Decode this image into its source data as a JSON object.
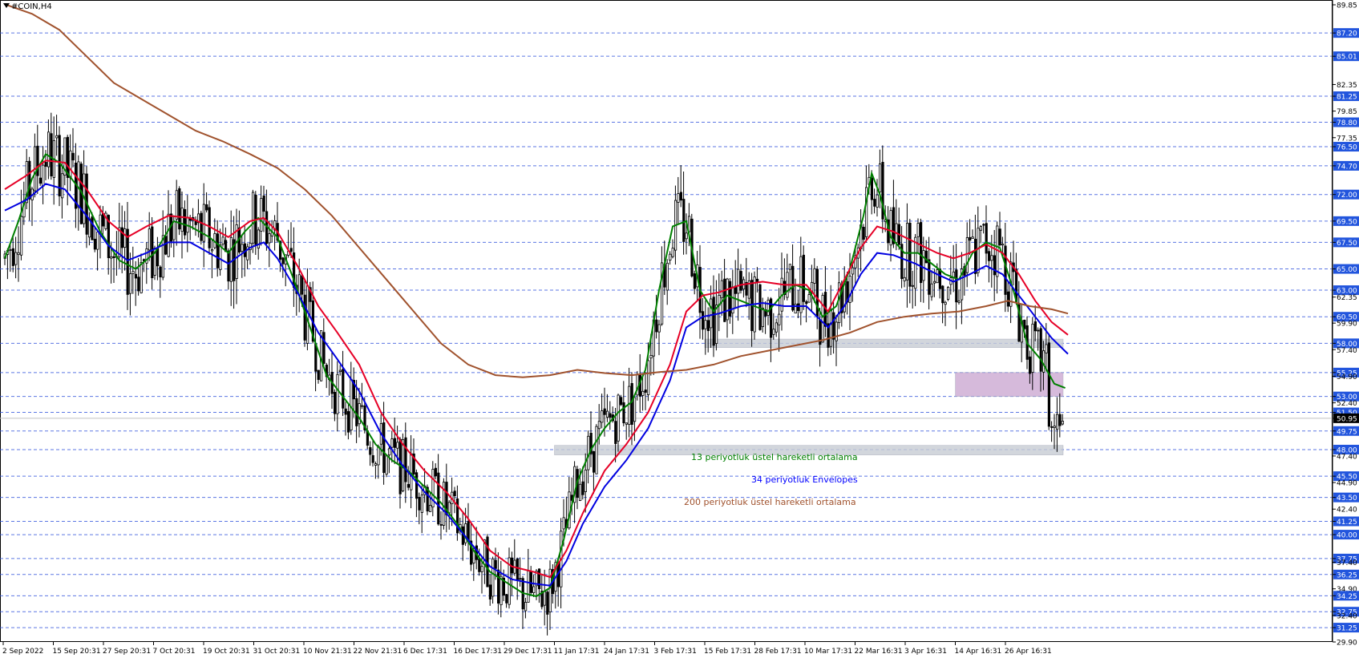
{
  "window": {
    "symbol_title": "#COIN,H4"
  },
  "annotations": [
    {
      "text": "13 periyotluk üstel hareketli ortalama",
      "color": "#008000"
    },
    {
      "text": "34 periyotluk Envelopes",
      "color": "#0000ff"
    },
    {
      "text": "200 periyotluk üstel hareketli ortalama",
      "color": "#a0522d"
    }
  ],
  "colors": {
    "grid": "#3355dd",
    "axis_tag_bg": "#2255dd",
    "candle": "#000000",
    "ema13": "#008000",
    "envelope_upper": "#e60026",
    "envelope_lower": "#0000e0",
    "ema200": "#a0522d",
    "zone_gray": "#c8ccd4",
    "zone_purple": "#c9a3cf",
    "current_price_line": "#c0c0c0"
  },
  "chart_data": {
    "type": "candlestick",
    "title": "#COIN,H4",
    "ylim": [
      29.9,
      89.85
    ],
    "grid": true,
    "x_tick_labels": [
      "2 Sep 2022",
      "15 Sep 20:31",
      "27 Sep 20:31",
      "7 Oct 20:31",
      "19 Oct 20:31",
      "31 Oct 20:31",
      "10 Nov 21:31",
      "22 Nov 21:31",
      "6 Dec 17:31",
      "16 Dec 17:31",
      "29 Dec 17:31",
      "11 Jan 17:31",
      "24 Jan 17:31",
      "3 Feb 17:31",
      "15 Feb 17:31",
      "28 Feb 17:31",
      "10 Mar 17:31",
      "22 Mar 16:31",
      "3 Apr 16:31",
      "14 Apr 16:31",
      "26 Apr 16:31"
    ],
    "y_tick_labels": [
      "89.85",
      "87.20",
      "85.01",
      "82.35",
      "81.25",
      "79.85",
      "78.80",
      "77.35",
      "76.50",
      "74.70",
      "72.00",
      "69.50",
      "67.50",
      "65.00",
      "63.00",
      "62.35",
      "60.50",
      "59.90",
      "58.00",
      "57.40",
      "55.25",
      "54.90",
      "53.00",
      "52.40",
      "51.50",
      "50.95",
      "49.75",
      "48.00",
      "47.40",
      "45.50",
      "44.90",
      "43.50",
      "42.40",
      "41.25",
      "40.00",
      "37.75",
      "37.40",
      "36.25",
      "34.90",
      "34.25",
      "32.75",
      "32.40",
      "31.25",
      "29.90"
    ],
    "highlighted_levels": [
      87.2,
      85.01,
      81.25,
      78.8,
      76.5,
      74.7,
      72.0,
      69.5,
      67.5,
      65.0,
      63.0,
      60.5,
      58.0,
      55.25,
      53.0,
      51.5,
      49.75,
      48.0,
      45.5,
      43.5,
      41.25,
      40.0,
      37.75,
      36.25,
      34.25,
      32.75,
      31.25
    ],
    "current_price": 50.95,
    "zones": [
      {
        "from": 57.6,
        "to": 58.4,
        "start": "15 Feb 17:31",
        "end": "26 Apr 16:31",
        "color": "gray"
      },
      {
        "from": 53.0,
        "to": 55.25,
        "start": "14 Apr 16:31",
        "end": "26 Apr 16:31",
        "color": "purple"
      },
      {
        "from": 47.5,
        "to": 48.4,
        "start": "11 Jan 17:31",
        "end": "26 Apr 16:31",
        "color": "gray"
      }
    ],
    "series": [
      {
        "name": "13 periyotluk üstel hareketli ortalama",
        "role": "ema13",
        "points": [
          [
            0,
            66.0
          ],
          [
            5,
            69.5
          ],
          [
            10,
            73.5
          ],
          [
            15,
            75.8
          ],
          [
            20,
            75.0
          ],
          [
            28,
            72.3
          ],
          [
            35,
            68.5
          ],
          [
            42,
            65.8
          ],
          [
            48,
            65.0
          ],
          [
            55,
            66.5
          ],
          [
            62,
            69.5
          ],
          [
            68,
            69.0
          ],
          [
            75,
            68.0
          ],
          [
            82,
            66.5
          ],
          [
            88,
            68.5
          ],
          [
            93,
            69.8
          ],
          [
            100,
            68.0
          ],
          [
            106,
            64.0
          ],
          [
            112,
            59.5
          ],
          [
            118,
            55.0
          ],
          [
            124,
            53.0
          ],
          [
            130,
            51.0
          ],
          [
            136,
            48.5
          ],
          [
            142,
            47.0
          ],
          [
            148,
            46.0
          ],
          [
            154,
            44.5
          ],
          [
            160,
            43.0
          ],
          [
            166,
            41.0
          ],
          [
            172,
            38.5
          ],
          [
            178,
            36.5
          ],
          [
            184,
            35.5
          ],
          [
            190,
            34.5
          ],
          [
            195,
            34.2
          ],
          [
            200,
            35.0
          ],
          [
            205,
            39.5
          ],
          [
            210,
            45.0
          ],
          [
            215,
            48.0
          ],
          [
            220,
            50.0
          ],
          [
            225,
            51.5
          ],
          [
            230,
            52.5
          ],
          [
            235,
            55.5
          ],
          [
            240,
            63.0
          ],
          [
            245,
            69.0
          ],
          [
            250,
            69.5
          ],
          [
            255,
            63.0
          ],
          [
            260,
            61.0
          ],
          [
            265,
            62.5
          ],
          [
            270,
            62.0
          ],
          [
            275,
            61.5
          ],
          [
            280,
            61.0
          ],
          [
            285,
            62.5
          ],
          [
            290,
            63.5
          ],
          [
            295,
            63.0
          ],
          [
            300,
            60.5
          ],
          [
            305,
            61.5
          ],
          [
            310,
            65.0
          ],
          [
            315,
            70.0
          ],
          [
            318,
            74.0
          ],
          [
            321,
            72.0
          ],
          [
            325,
            68.0
          ],
          [
            330,
            66.5
          ],
          [
            335,
            66.5
          ],
          [
            340,
            65.5
          ],
          [
            345,
            64.5
          ],
          [
            350,
            64.0
          ],
          [
            355,
            66.5
          ],
          [
            360,
            67.5
          ],
          [
            365,
            67.0
          ],
          [
            370,
            63.0
          ],
          [
            375,
            58.0
          ],
          [
            380,
            56.5
          ],
          [
            385,
            54.2
          ],
          [
            389,
            53.8
          ]
        ]
      },
      {
        "name": "",
        "role": "envelope_upper",
        "points": [
          [
            0,
            72.5
          ],
          [
            8,
            73.8
          ],
          [
            15,
            75.2
          ],
          [
            22,
            75.0
          ],
          [
            30,
            72.5
          ],
          [
            38,
            69.5
          ],
          [
            45,
            68.0
          ],
          [
            52,
            69.0
          ],
          [
            60,
            70.0
          ],
          [
            68,
            69.8
          ],
          [
            75,
            69.0
          ],
          [
            82,
            68.0
          ],
          [
            90,
            69.5
          ],
          [
            95,
            69.8
          ],
          [
            100,
            68.5
          ],
          [
            108,
            65.0
          ],
          [
            115,
            61.5
          ],
          [
            122,
            59.0
          ],
          [
            130,
            56.0
          ],
          [
            138,
            51.5
          ],
          [
            146,
            48.5
          ],
          [
            154,
            46.0
          ],
          [
            162,
            44.0
          ],
          [
            170,
            41.5
          ],
          [
            178,
            38.5
          ],
          [
            186,
            37.0
          ],
          [
            194,
            36.5
          ],
          [
            200,
            36.0
          ],
          [
            206,
            38.5
          ],
          [
            212,
            42.0
          ],
          [
            220,
            46.0
          ],
          [
            228,
            48.5
          ],
          [
            236,
            51.5
          ],
          [
            244,
            56.0
          ],
          [
            250,
            61.0
          ],
          [
            256,
            62.5
          ],
          [
            262,
            62.8
          ],
          [
            270,
            63.5
          ],
          [
            278,
            63.8
          ],
          [
            286,
            63.5
          ],
          [
            294,
            63.5
          ],
          [
            302,
            61.0
          ],
          [
            308,
            64.0
          ],
          [
            314,
            67.0
          ],
          [
            320,
            69.0
          ],
          [
            326,
            68.5
          ],
          [
            334,
            67.5
          ],
          [
            342,
            66.5
          ],
          [
            348,
            66.0
          ],
          [
            354,
            66.5
          ],
          [
            360,
            67.3
          ],
          [
            366,
            66.5
          ],
          [
            372,
            64.5
          ],
          [
            378,
            62.0
          ],
          [
            384,
            60.0
          ],
          [
            390,
            58.8
          ]
        ]
      },
      {
        "name": "",
        "role": "envelope_lower",
        "points": [
          [
            0,
            70.5
          ],
          [
            8,
            71.5
          ],
          [
            15,
            73.0
          ],
          [
            22,
            72.5
          ],
          [
            30,
            70.0
          ],
          [
            38,
            67.2
          ],
          [
            45,
            65.8
          ],
          [
            52,
            66.5
          ],
          [
            60,
            67.5
          ],
          [
            68,
            67.5
          ],
          [
            75,
            66.5
          ],
          [
            82,
            65.5
          ],
          [
            90,
            67.0
          ],
          [
            95,
            67.5
          ],
          [
            100,
            66.0
          ],
          [
            108,
            62.5
          ],
          [
            115,
            59.0
          ],
          [
            122,
            56.5
          ],
          [
            130,
            53.5
          ],
          [
            138,
            49.5
          ],
          [
            146,
            46.5
          ],
          [
            154,
            44.0
          ],
          [
            162,
            42.0
          ],
          [
            170,
            39.5
          ],
          [
            178,
            37.0
          ],
          [
            186,
            35.8
          ],
          [
            194,
            35.4
          ],
          [
            200,
            35.2
          ],
          [
            206,
            37.5
          ],
          [
            212,
            41.0
          ],
          [
            220,
            44.5
          ],
          [
            228,
            47.0
          ],
          [
            236,
            50.0
          ],
          [
            244,
            54.5
          ],
          [
            250,
            59.5
          ],
          [
            256,
            60.5
          ],
          [
            262,
            60.8
          ],
          [
            270,
            61.5
          ],
          [
            278,
            61.8
          ],
          [
            286,
            61.5
          ],
          [
            294,
            61.5
          ],
          [
            302,
            59.5
          ],
          [
            308,
            61.5
          ],
          [
            314,
            64.5
          ],
          [
            320,
            66.5
          ],
          [
            326,
            66.3
          ],
          [
            334,
            65.5
          ],
          [
            342,
            64.5
          ],
          [
            348,
            63.8
          ],
          [
            354,
            64.5
          ],
          [
            360,
            65.3
          ],
          [
            366,
            64.5
          ],
          [
            372,
            62.5
          ],
          [
            378,
            60.5
          ],
          [
            384,
            58.5
          ],
          [
            390,
            57.0
          ]
        ]
      },
      {
        "name": "200 periyotluk üstel hareketli ortalama",
        "role": "ema200",
        "points": [
          [
            0,
            89.9
          ],
          [
            10,
            89.0
          ],
          [
            20,
            87.5
          ],
          [
            30,
            85.0
          ],
          [
            40,
            82.5
          ],
          [
            50,
            81.0
          ],
          [
            60,
            79.5
          ],
          [
            70,
            78.0
          ],
          [
            80,
            77.0
          ],
          [
            90,
            75.8
          ],
          [
            100,
            74.5
          ],
          [
            110,
            72.5
          ],
          [
            120,
            70.0
          ],
          [
            130,
            67.0
          ],
          [
            140,
            64.0
          ],
          [
            150,
            61.0
          ],
          [
            160,
            58.0
          ],
          [
            170,
            56.0
          ],
          [
            180,
            55.0
          ],
          [
            190,
            54.8
          ],
          [
            200,
            55.0
          ],
          [
            210,
            55.5
          ],
          [
            220,
            55.2
          ],
          [
            230,
            55.0
          ],
          [
            240,
            55.3
          ],
          [
            250,
            55.5
          ],
          [
            260,
            56.0
          ],
          [
            270,
            56.8
          ],
          [
            280,
            57.3
          ],
          [
            290,
            57.8
          ],
          [
            300,
            58.3
          ],
          [
            310,
            59.0
          ],
          [
            320,
            60.0
          ],
          [
            330,
            60.5
          ],
          [
            340,
            60.8
          ],
          [
            350,
            61.0
          ],
          [
            360,
            61.5
          ],
          [
            368,
            62.0
          ],
          [
            376,
            61.5
          ],
          [
            384,
            61.2
          ],
          [
            390,
            60.8
          ]
        ]
      }
    ]
  }
}
